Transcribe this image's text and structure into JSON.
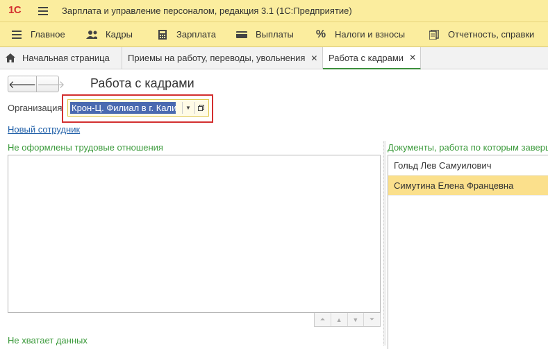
{
  "app": {
    "logo": "1С",
    "title": "Зарплата и управление персоналом, редакция 3.1  (1С:Предприятие)"
  },
  "sections": [
    {
      "label": "Главное",
      "icon": "menu-lines-icon"
    },
    {
      "label": "Кадры",
      "icon": "people-icon"
    },
    {
      "label": "Зарплата",
      "icon": "calculator-icon"
    },
    {
      "label": "Выплаты",
      "icon": "wallet-icon"
    },
    {
      "label": "Налоги и взносы",
      "icon": "percent-icon"
    },
    {
      "label": "Отчетность, справки",
      "icon": "report-icon"
    }
  ],
  "tabs": [
    {
      "label": "Начальная страница",
      "icon": "home-icon"
    },
    {
      "label": "Приемы на работу, переводы, увольнения"
    },
    {
      "label": "Работа с кадрами",
      "active": true
    }
  ],
  "form": {
    "title": "Работа с кадрами",
    "org_label": "Организация",
    "org_value": "Крон-Ц. Филиал в г. Калининграде",
    "new_employee": "Новый сотрудник"
  },
  "left_panel": {
    "header": "Не оформлены трудовые отношения",
    "rows": [],
    "bottom_header": "Не хватает данных"
  },
  "right_panel": {
    "header": "Документы, работа по которым заверш",
    "rows": [
      {
        "name": "Гольд Лев Самуилович",
        "selected": false
      },
      {
        "name": "Симутина Елена Францевна",
        "selected": true
      }
    ]
  },
  "colors": {
    "titlebar": "#fbed9e",
    "accent_green": "#3b9a3b",
    "highlight_border": "#d32f2f",
    "selection": "#fbe08c"
  }
}
